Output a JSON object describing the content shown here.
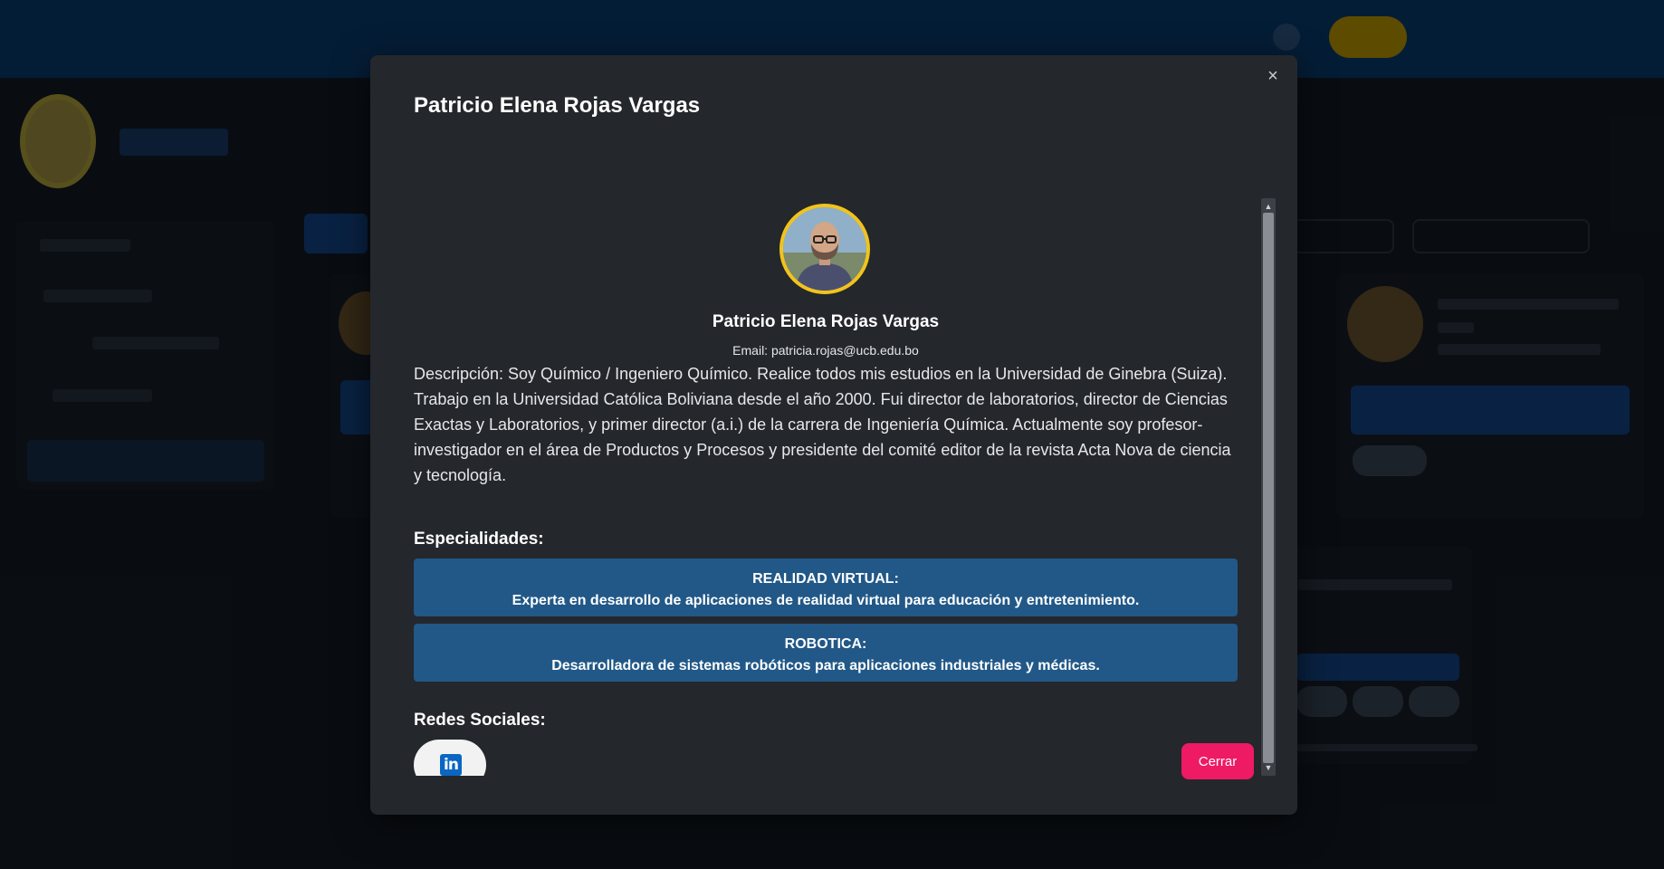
{
  "modal": {
    "title": "Patricio Elena Rojas Vargas",
    "close_icon": "×",
    "profile": {
      "name": "Patricio Elena Rojas Vargas",
      "email": "Email: patricia.rojas@ucb.edu.bo",
      "description": "Descripción: Soy Químico / Ingeniero Químico. Realice todos mis estudios en la Universidad de Ginebra (Suiza). Trabajo en la Universidad Católica Boliviana desde el año 2000. Fui director de laboratorios, director de Ciencias Exactas y Laboratorios, y primer director (a.i.) de la carrera de Ingeniería Química. Actualmente soy profesor-investigador en el área de Productos y Procesos y presidente del comité editor de la revista Acta Nova de ciencia y tecnología."
    },
    "specialties_heading": "Especialidades:",
    "specialties": [
      {
        "title": "REALIDAD VIRTUAL:",
        "text": "Experta en desarrollo de aplicaciones de realidad virtual para educación y entretenimiento."
      },
      {
        "title": "ROBOTICA:",
        "text": "Desarrolladora de sistemas robóticos para aplicaciones industriales y médicas."
      }
    ],
    "social_heading": "Redes Sociales:",
    "social": [
      {
        "icon": "linkedin-icon",
        "glyph": "in"
      }
    ],
    "close_button": "Cerrar"
  },
  "colors": {
    "modal_bg": "#24272c",
    "specialty_bg": "#215887",
    "close_button": "#ee1a63",
    "avatar_border": "#f2c31b",
    "topbar": "#0b4d8f"
  }
}
